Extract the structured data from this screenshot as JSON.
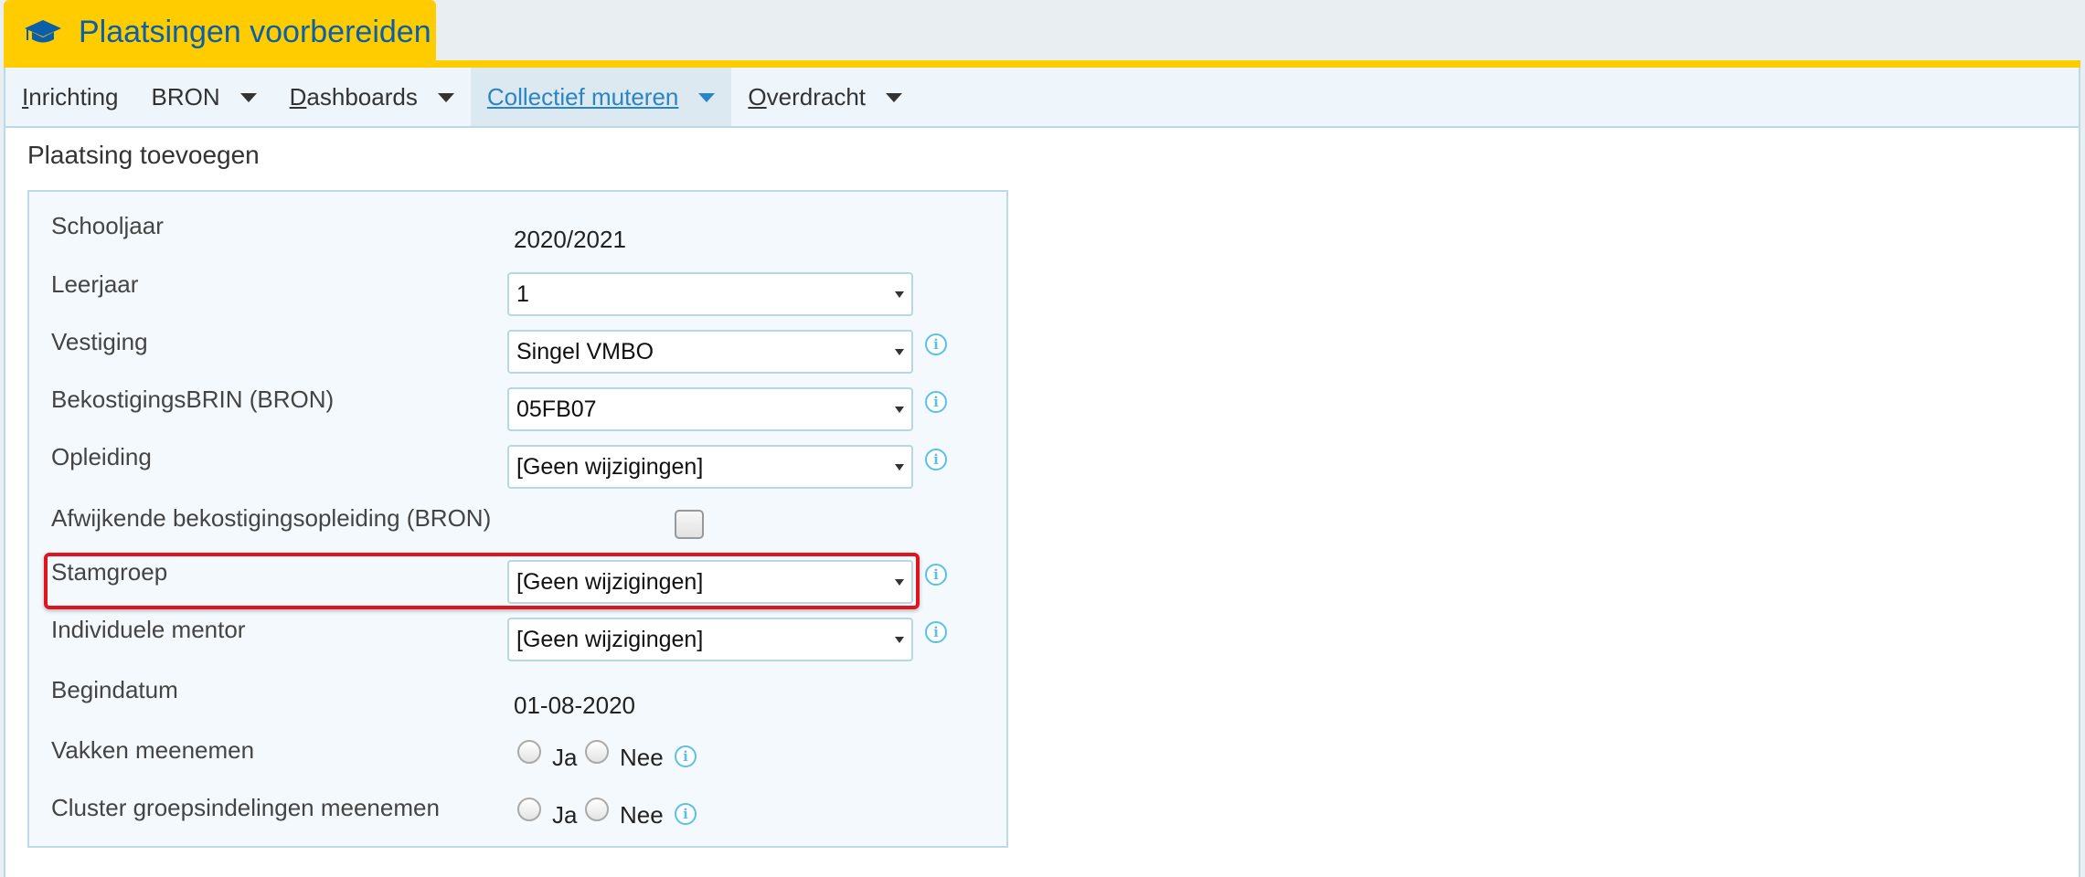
{
  "app": {
    "title": "Plaatsingen voorbereiden",
    "title_icon": "graduation-cap-icon",
    "accent_color": "#ffcc00",
    "link_color": "#2a84c6"
  },
  "menu": {
    "items": [
      {
        "first": "I",
        "rest": "nrichting",
        "has_dropdown": false,
        "active": false
      },
      {
        "first": "",
        "rest": "BRON",
        "has_dropdown": true,
        "active": false
      },
      {
        "first": "D",
        "rest": "ashboards",
        "has_dropdown": true,
        "active": false
      },
      {
        "first": "C",
        "rest": "ollectief muteren",
        "has_dropdown": true,
        "active": true
      },
      {
        "first": "O",
        "rest": "verdracht",
        "has_dropdown": true,
        "active": false
      }
    ]
  },
  "section": {
    "title": "Plaatsing toevoegen"
  },
  "form": {
    "schooljaar": {
      "label": "Schooljaar",
      "value": "2020/2021"
    },
    "leerjaar": {
      "label": "Leerjaar",
      "value": "1"
    },
    "vestiging": {
      "label": "Vestiging",
      "value": "Singel VMBO"
    },
    "bekostigingsbrin": {
      "label": "BekostigingsBRIN (BRON)",
      "value": "05FB07"
    },
    "opleiding": {
      "label": "Opleiding",
      "value": "[Geen wijzigingen]"
    },
    "afwijkende": {
      "label": "Afwijkende bekostigingsopleiding (BRON)",
      "checked": false
    },
    "stamgroep": {
      "label": "Stamgroep",
      "value": "[Geen wijzigingen]",
      "highlighted": true
    },
    "mentor": {
      "label": "Individuele mentor",
      "value": "[Geen wijzigingen]"
    },
    "begindatum": {
      "label": "Begindatum",
      "value": "01-08-2020"
    },
    "vakken": {
      "label": "Vakken meenemen",
      "option_yes": "Ja",
      "option_no": "Nee"
    },
    "cluster": {
      "label": "Cluster groepsindelingen meenemen",
      "option_yes": "Ja",
      "option_no": "Nee"
    }
  },
  "info_icon": {
    "glyph": "i",
    "color": "#5bc0e8"
  },
  "highlight_color": "#e0141e"
}
